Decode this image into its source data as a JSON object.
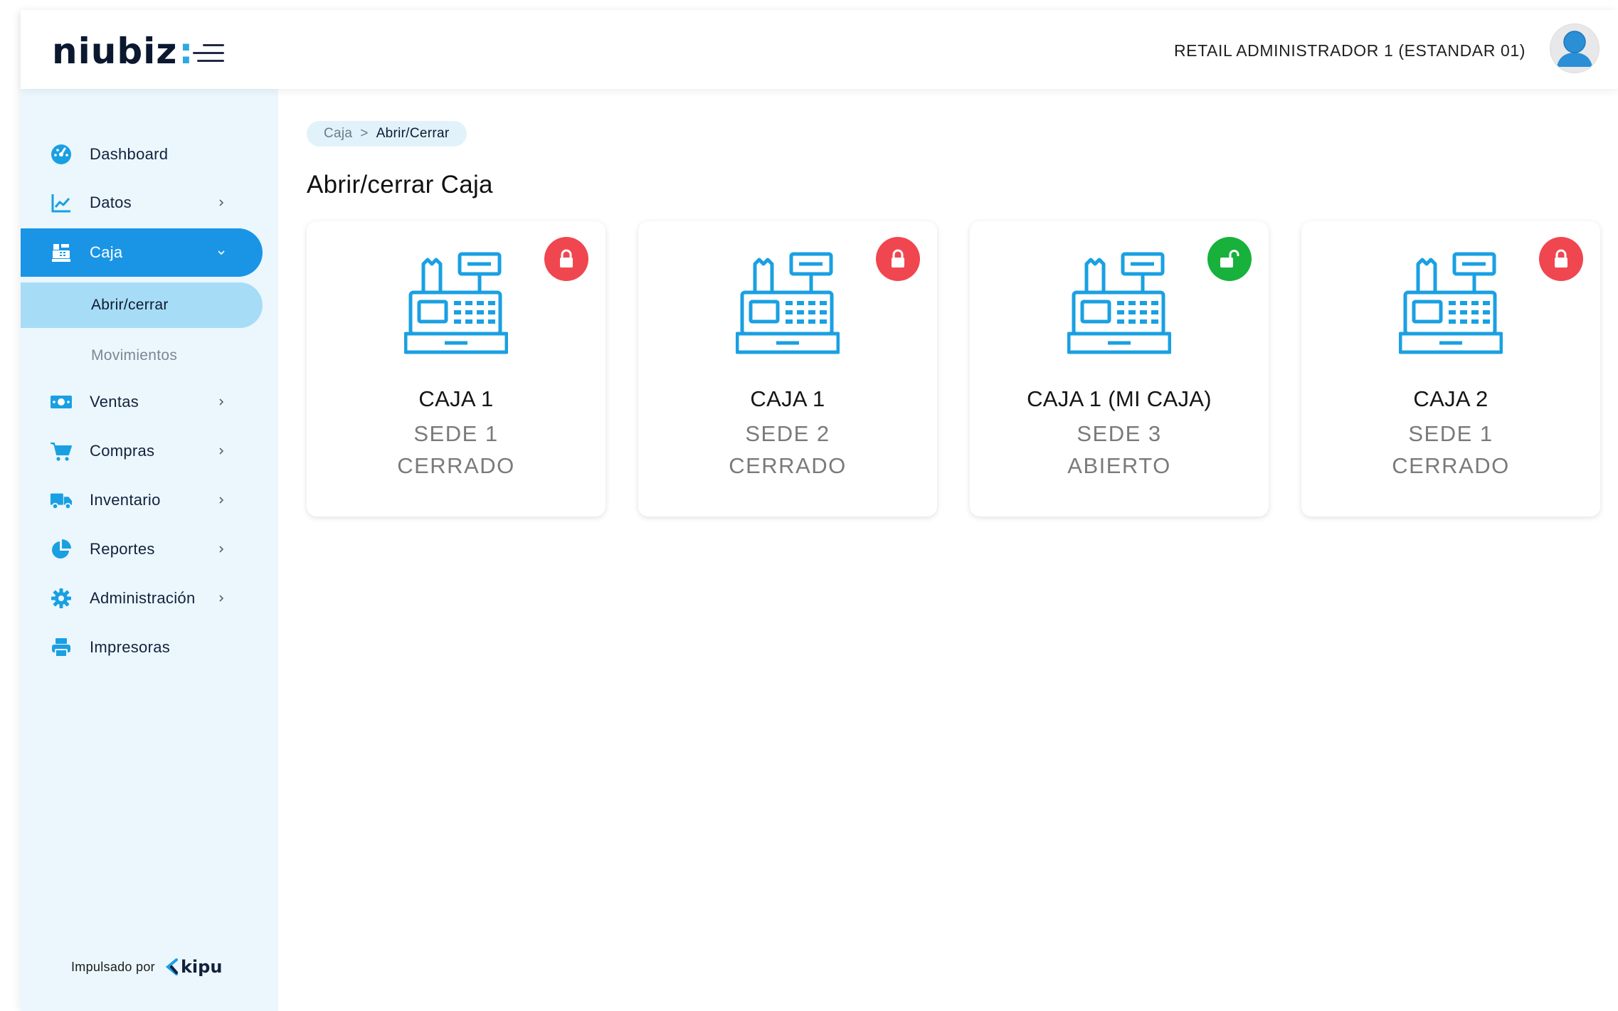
{
  "header": {
    "logo_text": "niubiz",
    "logo_colon": ":",
    "user_name": "RETAIL ADMINISTRADOR 1 (ESTANDAR 01)"
  },
  "colors": {
    "accent": "#1a95e6",
    "icon_blue": "#1aa0e2",
    "locked_red": "#f04650",
    "unlocked_green": "#17b13c",
    "sidebar_bg": "#ebf7fd"
  },
  "sidebar": {
    "items": [
      {
        "label": "Dashboard",
        "icon": "gauge-icon"
      },
      {
        "label": "Datos",
        "icon": "line-chart-icon"
      },
      {
        "label": "Caja",
        "icon": "cash-register-icon"
      },
      {
        "label": "Abrir/cerrar"
      },
      {
        "label": "Movimientos"
      },
      {
        "label": "Ventas",
        "icon": "money-icon"
      },
      {
        "label": "Compras",
        "icon": "cart-icon"
      },
      {
        "label": "Inventario",
        "icon": "truck-icon"
      },
      {
        "label": "Reportes",
        "icon": "pie-chart-icon"
      },
      {
        "label": "Administración",
        "icon": "gear-icon"
      },
      {
        "label": "Impresoras",
        "icon": "printer-icon"
      }
    ],
    "powered_label": "Impulsado por",
    "powered_brand": "kipu"
  },
  "breadcrumb": {
    "parent": "Caja",
    "separator": ">",
    "current": "Abrir/Cerrar"
  },
  "page_title": "Abrir/cerrar Caja",
  "cards": [
    {
      "name": "CAJA 1",
      "sede": "SEDE 1",
      "status": "CERRADO",
      "lock": "closed-lock-icon"
    },
    {
      "name": "CAJA 1",
      "sede": "SEDE 2",
      "status": "CERRADO",
      "lock": "closed-lock-icon"
    },
    {
      "name": "CAJA 1 (MI CAJA)",
      "sede": "SEDE 3",
      "status": "ABIERTO",
      "lock": "open-lock-icon"
    },
    {
      "name": "CAJA 2",
      "sede": "SEDE 1",
      "status": "CERRADO",
      "lock": "closed-lock-icon"
    }
  ]
}
